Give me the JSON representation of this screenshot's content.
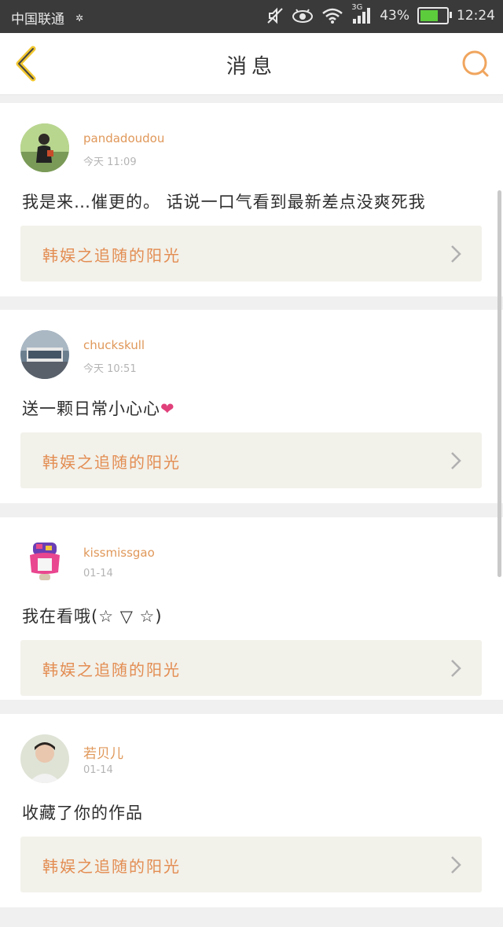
{
  "status_bar": {
    "carrier": "中国联通",
    "network": "3G",
    "battery": "43%",
    "battery_level": 0.43,
    "time": "12:24"
  },
  "header": {
    "title": "消息",
    "back_icon": "chevron-left-icon",
    "search_icon": "search-icon"
  },
  "colors": {
    "accent": "#e38d52",
    "link_bg": "#f2f1ea",
    "status_bg": "#3a3a3a"
  },
  "messages": [
    {
      "username": "pandadoudou",
      "time": "今天 11:09",
      "text": "我是来…催更的。 话说一口气看到最新差点没爽死我",
      "link": "韩娱之追随的阳光"
    },
    {
      "username": "chuckskull",
      "time": "今天 10:51",
      "text": "送一颗日常小心心",
      "emoji": "❤",
      "link": "韩娱之追随的阳光"
    },
    {
      "username": "kissmissgao",
      "time": "01-14",
      "text": "我在看哦(☆ ▽ ☆)",
      "link": "韩娱之追随的阳光"
    },
    {
      "username": "若贝儿",
      "time": "01-14",
      "text": "收藏了你的作品",
      "link": "韩娱之追随的阳光"
    }
  ]
}
